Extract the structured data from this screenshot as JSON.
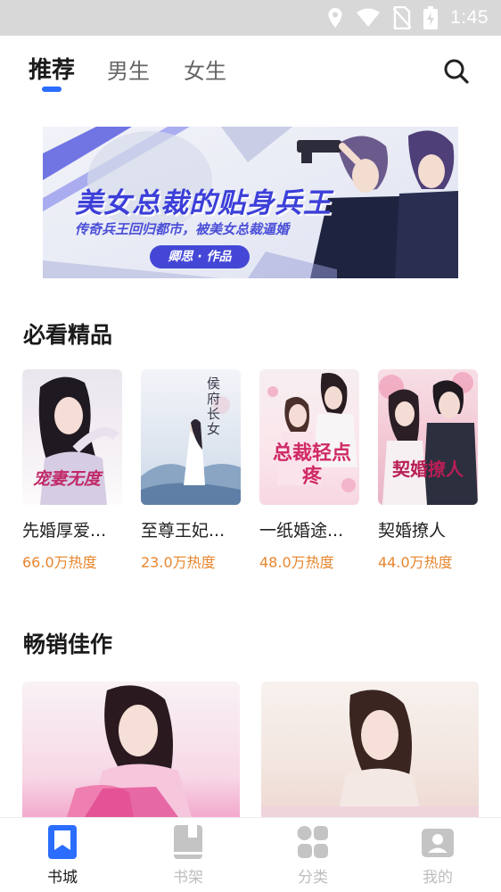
{
  "status_bar": {
    "time": "1:45"
  },
  "top_tabs": [
    {
      "label": "推荐",
      "active": true
    },
    {
      "label": "男生",
      "active": false
    },
    {
      "label": "女生",
      "active": false
    }
  ],
  "banner": {
    "title": "美女总裁的贴身兵王",
    "subtitle": "传奇兵王回归都市，被美女总裁逼婚",
    "author": "卿思 · 作品"
  },
  "sections": {
    "must_read": "必看精品",
    "bestsellers": "畅销佳作"
  },
  "books": [
    {
      "name": "先婚厚爱...",
      "heat": "66.0万热度",
      "cover_text": "宠妻无度"
    },
    {
      "name": "至尊王妃...",
      "heat": "23.0万热度",
      "cover_text": "侯府长女"
    },
    {
      "name": "一纸婚途...",
      "heat": "48.0万热度",
      "cover_text": "总裁轻点疼"
    },
    {
      "name": "契婚撩人",
      "heat": "44.0万热度",
      "cover_text": "契婚撩人"
    }
  ],
  "bottom_nav": [
    {
      "label": "书城",
      "icon": "bookmark-icon",
      "active": true
    },
    {
      "label": "书架",
      "icon": "book-icon",
      "active": false
    },
    {
      "label": "分类",
      "icon": "grid-icon",
      "active": false
    },
    {
      "label": "我的",
      "icon": "user-icon",
      "active": false
    }
  ],
  "colors": {
    "accent": "#2a6dff",
    "heat": "#e8862e",
    "banner_title": "#3c3fd8"
  }
}
